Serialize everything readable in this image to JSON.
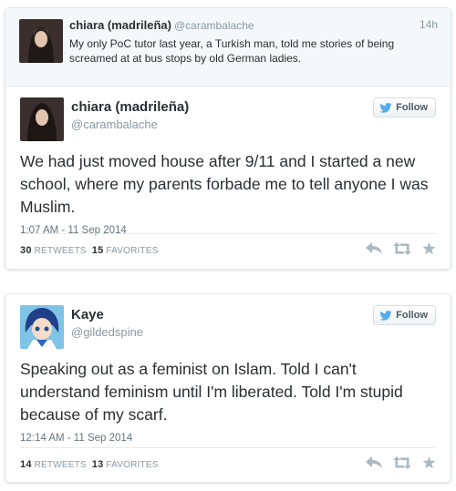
{
  "card1": {
    "parent": {
      "name": "chiara (madrileña)",
      "handle": "@carambalache",
      "time": "14h",
      "text": "My only PoC tutor last year, a Turkish man, told me stories of being screamed at at bus stops by old German ladies."
    },
    "main": {
      "name": "chiara (madrileña)",
      "handle": "@carambalache",
      "follow_label": "Follow",
      "text": "We had just moved house after 9/11 and I started a new school, where my parents forbade me to tell anyone I was Muslim.",
      "timestamp": "1:07 AM - 11 Sep 2014",
      "retweets": "30",
      "retweets_label": "RETWEETS",
      "favorites": "15",
      "favorites_label": "FAVORITES"
    }
  },
  "card2": {
    "main": {
      "name": "Kaye",
      "handle": "@gildedspine",
      "follow_label": "Follow",
      "text": "Speaking out as a feminist on Islam. Told I can't understand feminism until I'm liberated. Told I'm stupid because of my scarf.",
      "timestamp": "12:14 AM - 11 Sep 2014",
      "retweets": "14",
      "retweets_label": "RETWEETS",
      "favorites": "13",
      "favorites_label": "FAVORITES"
    }
  },
  "colors": {
    "twitter_blue": "#55acee",
    "muted": "#8899a6",
    "text": "#292f33",
    "action_icon": "#aab8c2"
  },
  "icons": [
    "reply-icon",
    "retweet-icon",
    "favorite-icon",
    "twitter-bird-icon"
  ]
}
